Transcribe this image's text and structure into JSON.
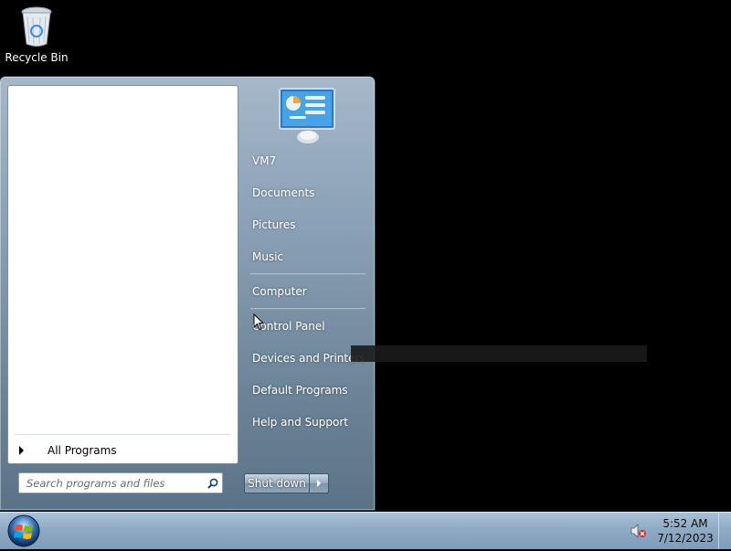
{
  "desktop": {
    "icons": [
      {
        "label": "Recycle Bin",
        "icon": "recycle-bin-icon"
      }
    ]
  },
  "start_menu": {
    "all_programs_label": "All Programs",
    "search": {
      "placeholder": "Search programs and files",
      "value": ""
    },
    "right_items": [
      {
        "label": "VM7"
      },
      {
        "label": "Documents"
      },
      {
        "label": "Pictures"
      },
      {
        "label": "Music"
      },
      {
        "label": "Computer"
      },
      {
        "label": "Control Panel"
      },
      {
        "label": "Devices and Printers"
      },
      {
        "label": "Default Programs"
      },
      {
        "label": "Help and Support"
      }
    ],
    "shutdown_label": "Shut down"
  },
  "taskbar": {
    "clock_time": "5:52 AM",
    "clock_date": "7/12/2023",
    "tray_icons": [
      "speaker-muted-icon"
    ]
  },
  "colors": {
    "desktop_bg": "#000000",
    "menu_accent": "#8aa0b6",
    "taskbar": "#8fabc5"
  }
}
